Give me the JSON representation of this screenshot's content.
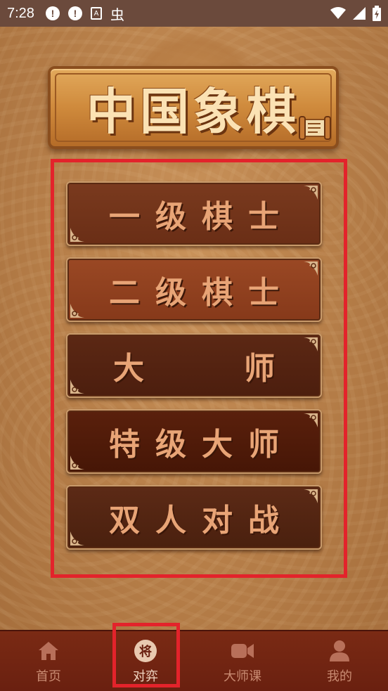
{
  "status_bar": {
    "time": "7:28",
    "alert1": "!",
    "alert2": "!",
    "a_badge": "A",
    "bug": "虫"
  },
  "title": "中国象棋",
  "menu": [
    {
      "label": "一级棋士"
    },
    {
      "label": "二级棋士"
    },
    {
      "label_left": "大",
      "label_right": "师"
    },
    {
      "label": "特级大师"
    },
    {
      "label": "双人对战"
    }
  ],
  "bottom_nav": [
    {
      "label": "首页",
      "icon": "home-icon"
    },
    {
      "label": "对弈",
      "icon": "general-piece-icon",
      "badge": "将",
      "active": true
    },
    {
      "label": "大师课",
      "icon": "video-icon"
    },
    {
      "label": "我的",
      "icon": "user-icon"
    }
  ],
  "colors": {
    "highlight": "#e3232b",
    "status_bar": "#6b4a3c",
    "nav_bg": "#7a2a14"
  }
}
